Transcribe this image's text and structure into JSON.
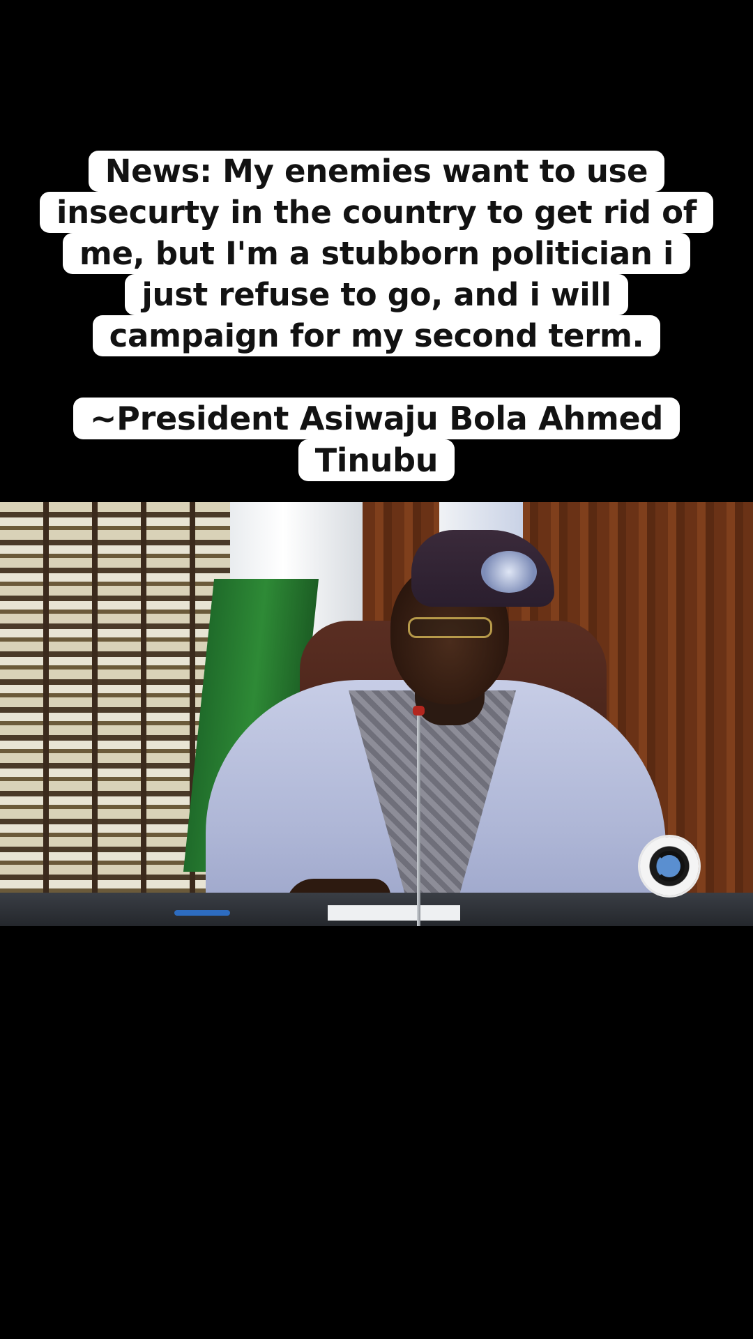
{
  "caption": {
    "lines": [
      "News: My enemies want to use",
      "insecurty in the country to get rid of",
      "me, but I'm a stubborn politician i",
      "just refuse to go, and i will",
      "campaign for my second term."
    ]
  },
  "attribution": {
    "lines": [
      "~President Asiwaju Bola Ahmed",
      "Tinubu"
    ]
  },
  "video": {
    "logo_icon": "channel-watermark-icon"
  },
  "colors": {
    "background": "#000000",
    "caption_bg": "#ffffff",
    "caption_text": "#121212"
  }
}
